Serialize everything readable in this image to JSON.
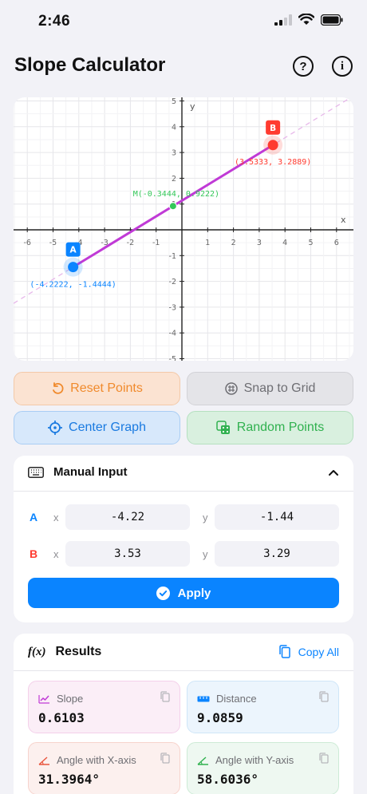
{
  "status_bar": {
    "time": "2:46",
    "icons": [
      "signal-icon",
      "wifi-icon",
      "battery-icon"
    ]
  },
  "header": {
    "title": "Slope Calculator",
    "help_label": "?",
    "info_label": "i"
  },
  "graph": {
    "x_axis_label": "x",
    "y_axis_label": "y",
    "x_ticks": [
      "-6",
      "-5",
      "-4",
      "-3",
      "-2",
      "-1",
      "1",
      "2",
      "3",
      "4",
      "5",
      "6"
    ],
    "y_ticks": [
      "5",
      "4",
      "3",
      "2",
      "1",
      "-1",
      "-2",
      "-3",
      "-4",
      "-5"
    ],
    "point_a": {
      "label": "A",
      "x": -4.2222,
      "y": -1.4444,
      "coords": "(-4.2222, -1.4444)",
      "color": "#0a84ff"
    },
    "point_b": {
      "label": "B",
      "x": 3.5333,
      "y": 3.2889,
      "coords": "(3.5333, 3.2889)",
      "color": "#ff3b30"
    },
    "midpoint": {
      "x": -0.3444,
      "y": 0.9222,
      "label": "M(-0.3444, 0.9222)",
      "color": "#34c759"
    },
    "segment_color": "#c03ad6"
  },
  "actions": {
    "reset": "Reset Points",
    "snap": "Snap to Grid",
    "center": "Center Graph",
    "random": "Random Points"
  },
  "manual_input": {
    "title": "Manual Input",
    "a_label": "A",
    "b_label": "B",
    "x_label": "x",
    "y_label": "y",
    "a_x": "-4.22",
    "a_y": "-1.44",
    "b_x": "3.53",
    "b_y": "3.29",
    "apply": "Apply"
  },
  "results": {
    "icon_text": "f(x)",
    "title": "Results",
    "copy_all": "Copy All",
    "slope_label": "Slope",
    "slope_value": "0.6103",
    "distance_label": "Distance",
    "distance_value": "9.0859",
    "angle_x_label": "Angle with X-axis",
    "angle_x_value": "31.3964°",
    "angle_y_label": "Angle with Y-axis",
    "angle_y_value": "58.6036°"
  },
  "colors": {
    "accent": "#0a84ff",
    "point_a": "#0a84ff",
    "point_b": "#ff3b30",
    "midpoint": "#34c759"
  }
}
